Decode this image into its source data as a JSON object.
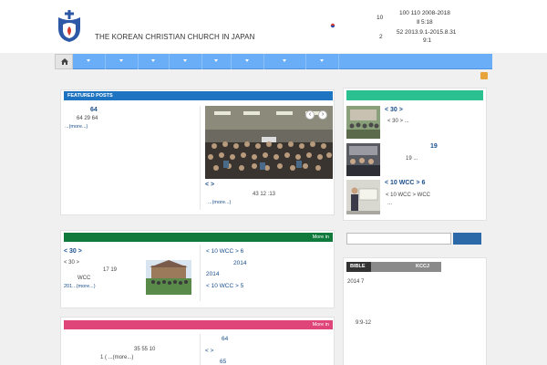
{
  "header": {
    "site_title": "THE KOREAN CHRISTIAN CHURCH IN JAPAN",
    "info": [
      {
        "text": "10"
      },
      {
        "text": "100   110   2008-2018"
      },
      {
        "text": "Ⅱ  5:18"
      },
      {
        "text": "2"
      },
      {
        "text": "52     2013.9.1-2015.8.31"
      },
      {
        "text": "9:1"
      }
    ]
  },
  "nav": {
    "item_count": 9
  },
  "featured": {
    "heading": "FEATURED POSTS",
    "left_title": "64",
    "left_text": "64       29         64",
    "left_more": "...(more...)",
    "slider_title": "<       >",
    "slider_text": "43           12 :13",
    "slider_more": "...(more...)",
    "prev_arrow": "‹",
    "next_arrow": "›"
  },
  "section2": {
    "more": "More in",
    "title": "<        30        >",
    "text1": "<      30      >",
    "text2": "17  19",
    "text3": "WCC",
    "text4": "201...(more...)",
    "right": [
      {
        "text": "< 10 WCC         > 6"
      },
      {
        "text": "2014"
      },
      {
        "text": "2014"
      },
      {
        "text": "< 10 WCC         > 5"
      }
    ]
  },
  "section3": {
    "more": "More in",
    "text1": "35 55       10",
    "text2": "1  (             ...(more...)",
    "right": [
      {
        "text": "64"
      },
      {
        "text": "<       >"
      },
      {
        "text": "65"
      }
    ]
  },
  "sidebar": {
    "list": [
      {
        "title": "<          30          >",
        "text": "<     30       >                        ..."
      },
      {
        "title": "19",
        "text": "19                                   ..."
      },
      {
        "title": "< 10  WCC        > 6",
        "text": "< 10  WCC        >              WCC",
        "extra": "..."
      }
    ],
    "search_placeholder": "",
    "tabs": [
      {
        "label": "BIBLE"
      },
      {
        "label": ""
      },
      {
        "label": ""
      },
      {
        "label": "KCCJ"
      }
    ],
    "tab_text1": "2014 7",
    "tab_text2": "9:9-12"
  },
  "colors": {
    "nav": "#6aaef7",
    "featured_bar": "#1f74c1",
    "sidebar_bar": "#2bc08f",
    "section2_bar": "#0f7a3b",
    "section3_bar": "#e0457a",
    "search_button": "#2b69a9"
  }
}
